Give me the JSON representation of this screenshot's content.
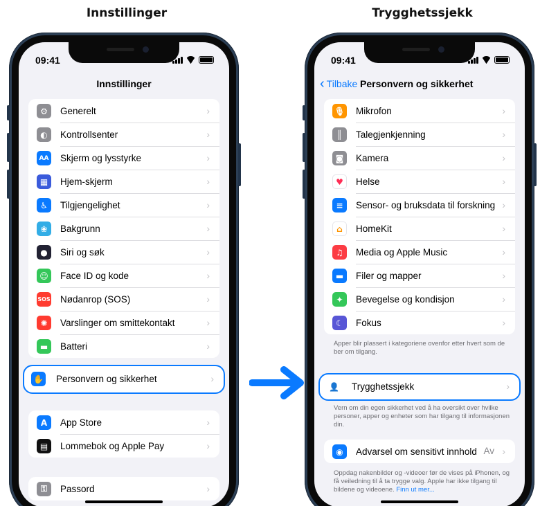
{
  "captions": {
    "left": "Innstillinger",
    "right": "Trygghetssjekk"
  },
  "status": {
    "time": "09:41"
  },
  "left_screen": {
    "title": "Innstillinger",
    "group1": [
      {
        "label": "Generelt",
        "icon": "gear-icon",
        "color": "#8e8e93"
      },
      {
        "label": "Kontrollsenter",
        "icon": "toggles-icon",
        "color": "#8e8e93"
      },
      {
        "label": "Skjerm og lysstyrke",
        "icon": "text-size-icon",
        "color": "#0a7aff"
      },
      {
        "label": "Hjem-skjerm",
        "icon": "app-grid-icon",
        "color": "#3b5bdb"
      },
      {
        "label": "Tilgjengelighet",
        "icon": "accessibility-icon",
        "color": "#0a7aff"
      },
      {
        "label": "Bakgrunn",
        "icon": "flower-icon",
        "color": "#32ade6"
      },
      {
        "label": "Siri og søk",
        "icon": "siri-icon",
        "color": "#222233"
      },
      {
        "label": "Face ID og kode",
        "icon": "face-id-icon",
        "color": "#34c759"
      },
      {
        "label": "Nødanrop (SOS)",
        "icon": "sos-icon",
        "color": "#ff3b30"
      },
      {
        "label": "Varslinger om smittekontakt",
        "icon": "exposure-icon",
        "color": "#ff3b30"
      },
      {
        "label": "Batteri",
        "icon": "battery-icon",
        "color": "#34c759"
      }
    ],
    "highlighted": {
      "label": "Personvern og sikkerhet",
      "icon": "hand-icon",
      "color": "#0a7aff"
    },
    "group2": [
      {
        "label": "App Store",
        "icon": "app-store-icon",
        "color": "#0a7aff"
      },
      {
        "label": "Lommebok og Apple Pay",
        "icon": "wallet-icon",
        "color": "#111111"
      }
    ],
    "group3": [
      {
        "label": "Passord",
        "icon": "key-icon",
        "color": "#8e8e93"
      }
    ]
  },
  "right_screen": {
    "back_label": "Tilbake",
    "title": "Personvern og sikkerhet",
    "group1": [
      {
        "label": "Mikrofon",
        "icon": "microphone-icon",
        "color": "#ff9500"
      },
      {
        "label": "Talegjenkjenning",
        "icon": "waveform-icon",
        "color": "#8e8e93"
      },
      {
        "label": "Kamera",
        "icon": "camera-icon",
        "color": "#8e8e93"
      },
      {
        "label": "Helse",
        "icon": "heart-icon",
        "color": "#ffffff"
      },
      {
        "label": "Sensor- og bruksdata til forskning",
        "icon": "research-icon",
        "color": "#0a7aff"
      },
      {
        "label": "HomeKit",
        "icon": "home-icon",
        "color": "#ffffff"
      },
      {
        "label": "Media og Apple Music",
        "icon": "music-icon",
        "color": "#fc3c44"
      },
      {
        "label": "Filer og mapper",
        "icon": "folder-icon",
        "color": "#0a7aff"
      },
      {
        "label": "Bevegelse og kondisjon",
        "icon": "running-icon",
        "color": "#34c759"
      },
      {
        "label": "Fokus",
        "icon": "moon-icon",
        "color": "#5856d6"
      }
    ],
    "footnote1": "Apper blir plassert i kategoriene ovenfor etter hvert som de ber om tilgang.",
    "highlighted": {
      "label": "Trygghetssjekk",
      "icon": "safety-check-icon",
      "color": "#0a7aff"
    },
    "footnote2": "Vern om din egen sikkerhet ved å ha oversikt over hvilke personer, apper og enheter som har tilgang til informasjonen din.",
    "sensitive": {
      "label": "Advarsel om sensitivt innhold",
      "value": "Av",
      "icon": "eye-warning-icon",
      "color": "#0a7aff"
    },
    "footnote3": "Oppdag nakenbilder og -videoer før de vises på iPhonen, og få veiledning til å ta trygge valg. Apple har ikke tilgang til bildene og videoene.",
    "footnote3_link": "Finn ut mer..."
  },
  "arrow_color": "#0a7aff"
}
